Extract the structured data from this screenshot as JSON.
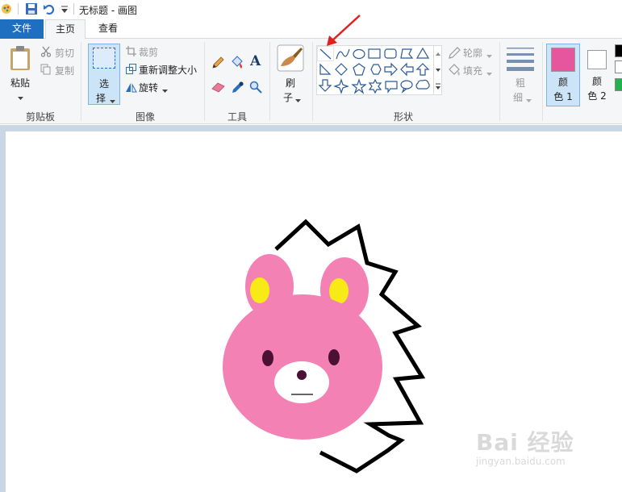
{
  "window": {
    "title": "无标题 - 画图"
  },
  "tabs": {
    "file": "文件",
    "home": "主页",
    "view": "查看"
  },
  "clipboard": {
    "paste": "粘贴",
    "cut": "剪切",
    "copy": "复制",
    "group": "剪贴板"
  },
  "image": {
    "select_top": "选",
    "select_bottom": "择",
    "crop": "裁剪",
    "resize": "重新调整大小",
    "rotate": "旋转",
    "group": "图像"
  },
  "tools": {
    "group": "工具"
  },
  "brushes": {
    "top": "刷",
    "bottom": "子"
  },
  "shapes": {
    "outline": "轮廓",
    "fill": "填充",
    "group": "形状"
  },
  "size": {
    "top": "粗",
    "bottom": "细"
  },
  "colors": {
    "color1_top": "颜",
    "color1_bottom": "色 1",
    "color2_top": "颜",
    "color2_bottom": "色 2",
    "color1_value": "#e5569e",
    "color2_value": "#ffffff"
  },
  "watermark": {
    "brand": "Bai 经验",
    "url": "jingyan.baidu.com"
  }
}
